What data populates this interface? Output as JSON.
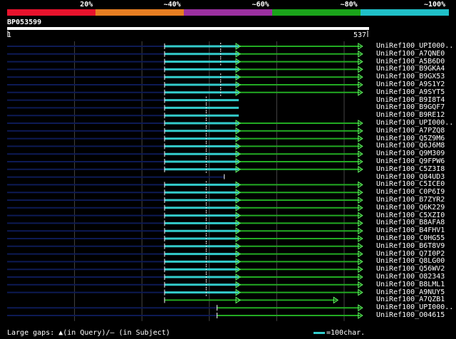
{
  "legend": {
    "segments": [
      {
        "label": "20%",
        "color": "#e8132d"
      },
      {
        "label": "~40%",
        "color": "#e67e22"
      },
      {
        "label": "~60%",
        "color": "#9b30a0"
      },
      {
        "label": "~80%",
        "color": "#1aa31a"
      },
      {
        "label": "~100%",
        "color": "#20c0c8"
      }
    ]
  },
  "query": {
    "name": "BP053599",
    "start": "1",
    "end": "537",
    "length": 537
  },
  "colors": {
    "cyan": "#33cccc",
    "green": "#22aa22",
    "navy": "#0d1a55",
    "grid": "#444444",
    "white": "#ffffff"
  },
  "hits": [
    {
      "label": "UniRef100_UPI000..",
      "type": "A",
      "gaps": [
        0.59
      ]
    },
    {
      "label": "UniRef100_A7QNE0",
      "type": "A",
      "gaps": [
        0.59
      ]
    },
    {
      "label": "UniRef100_A5B6D0",
      "type": "A",
      "gaps": [
        0.59
      ]
    },
    {
      "label": "UniRef100_B9GKA4",
      "type": "A",
      "gaps": []
    },
    {
      "label": "UniRef100_B9GX53",
      "type": "A",
      "gaps": [
        0.59
      ]
    },
    {
      "label": "UniRef100_A9S1Y2",
      "type": "A",
      "gaps": [
        0.59
      ]
    },
    {
      "label": "UniRef100_A9SYT5",
      "type": "A",
      "gaps": [
        0.59
      ]
    },
    {
      "label": "UniRef100_B9I8T4",
      "type": "B",
      "gaps": [
        0.55
      ]
    },
    {
      "label": "UniRef100_B9GQF7",
      "type": "B",
      "gaps": [
        0.55
      ]
    },
    {
      "label": "UniRef100_B9RE12",
      "type": "B",
      "gaps": [
        0.55
      ]
    },
    {
      "label": "UniRef100_UPI000..",
      "type": "A",
      "gaps": [
        0.55
      ]
    },
    {
      "label": "UniRef100_A7PZQ8",
      "type": "A",
      "gaps": [
        0.55
      ]
    },
    {
      "label": "UniRef100_Q5Z9M6",
      "type": "A",
      "gaps": [
        0.55
      ]
    },
    {
      "label": "UniRef100_Q6J6M8",
      "type": "A",
      "gaps": [
        0.55
      ]
    },
    {
      "label": "UniRef100_Q9M309",
      "type": "A",
      "gaps": [
        0.55
      ]
    },
    {
      "label": "UniRef100_Q9FPW6",
      "type": "A",
      "gaps": [
        0.55
      ]
    },
    {
      "label": "UniRef100_C5Z3I8",
      "type": "A",
      "gaps": [
        0.55
      ]
    },
    {
      "label": "UniRef100_Q84UD3",
      "type": "C",
      "gaps": []
    },
    {
      "label": "UniRef100_C5ICE0",
      "type": "A",
      "gaps": [
        0.55
      ]
    },
    {
      "label": "UniRef100_C0P6I9",
      "type": "A",
      "gaps": [
        0.55
      ]
    },
    {
      "label": "UniRef100_B7ZYR2",
      "type": "A",
      "gaps": [
        0.55
      ]
    },
    {
      "label": "UniRef100_Q6K229",
      "type": "A",
      "gaps": [
        0.55
      ]
    },
    {
      "label": "UniRef100_C5XZI0",
      "type": "A",
      "gaps": [
        0.55
      ]
    },
    {
      "label": "UniRef100_B8AFA8",
      "type": "A",
      "gaps": [
        0.55
      ]
    },
    {
      "label": "UniRef100_B4FHV1",
      "type": "A",
      "gaps": [
        0.55
      ]
    },
    {
      "label": "UniRef100_C0HG55",
      "type": "A",
      "gaps": [
        0.55
      ]
    },
    {
      "label": "UniRef100_B6T8V9",
      "type": "A",
      "gaps": [
        0.55
      ]
    },
    {
      "label": "UniRef100_Q7I0P2",
      "type": "A",
      "gaps": [
        0.55
      ]
    },
    {
      "label": "UniRef100_Q8LG00",
      "type": "A",
      "gaps": [
        0.55
      ]
    },
    {
      "label": "UniRef100_Q56WV2",
      "type": "A",
      "gaps": [
        0.55
      ]
    },
    {
      "label": "UniRef100_O82343",
      "type": "A",
      "gaps": [
        0.55
      ]
    },
    {
      "label": "UniRef100_B8LML1",
      "type": "A",
      "gaps": [
        0.55
      ]
    },
    {
      "label": "UniRef100_A9NUY5",
      "type": "A",
      "gaps": [
        0.55
      ]
    },
    {
      "label": "UniRef100_A7QZB1",
      "type": "D",
      "gaps": []
    },
    {
      "label": "UniRef100_UPI000..",
      "type": "E",
      "gaps": []
    },
    {
      "label": "UniRef100_O04615",
      "type": "E",
      "gaps": []
    }
  ],
  "footer": {
    "gap_legend": "Large gaps: ▲(in Query)/— (in Subject)",
    "scale_label": "=100char."
  }
}
